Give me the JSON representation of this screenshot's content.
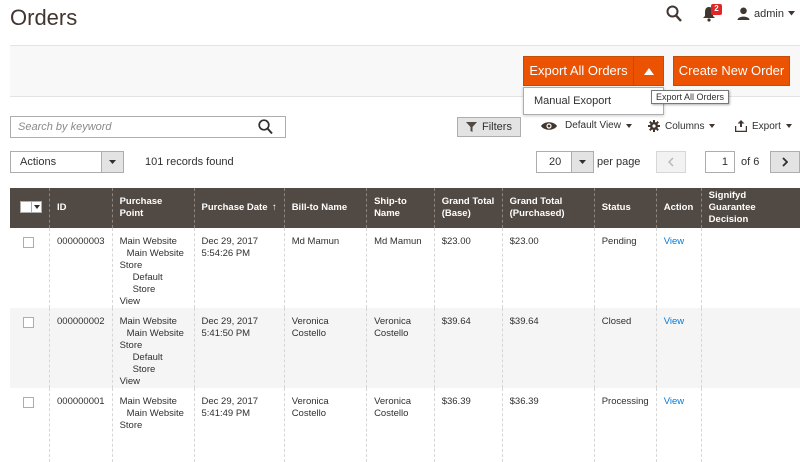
{
  "page": {
    "title": "Orders"
  },
  "topbar": {
    "notification_count": "2",
    "user": "admin"
  },
  "header_actions": {
    "export_all_label": "Export All Orders",
    "create_label": "Create New Order",
    "dropdown_item": "Manual Exoport",
    "tooltip": "Export All Orders"
  },
  "search": {
    "placeholder": "Search by keyword"
  },
  "toolbar": {
    "filters": "Filters",
    "default_view": "Default View",
    "columns": "Columns",
    "export": "Export"
  },
  "grid_controls": {
    "actions_label": "Actions",
    "records_found": "101 records found",
    "per_page_value": "20",
    "per_page_label": "per page",
    "current_page": "1",
    "total_pages": "of 6"
  },
  "table": {
    "columns": [
      "ID",
      "Purchase Point",
      "Purchase Date",
      "Bill-to Name",
      "Ship-to Name",
      "Grand Total (Base)",
      "Grand Total (Purchased)",
      "Status",
      "Action",
      "Signifyd Guarantee Decision"
    ],
    "rows": [
      {
        "id": "000000003",
        "pp1": "Main Website",
        "pp2": "Main Website",
        "pp3": "Store",
        "pp4": "Default Store",
        "pp5": "View",
        "date1": "Dec 29, 2017",
        "date2": "5:54:26 PM",
        "bill": "Md Mamun",
        "ship": "Md Mamun",
        "base": "$23.00",
        "purchased": "$23.00",
        "status": "Pending",
        "action": "View"
      },
      {
        "id": "000000002",
        "pp1": "Main Website",
        "pp2": "Main Website",
        "pp3": "Store",
        "pp4": "Default Store",
        "pp5": "View",
        "date1": "Dec 29, 2017",
        "date2": "5:41:50 PM",
        "bill": "Veronica Costello",
        "ship": "Veronica Costello",
        "base": "$39.64",
        "purchased": "$39.64",
        "status": "Closed",
        "action": "View"
      },
      {
        "id": "000000001",
        "pp1": "Main Website",
        "pp2": "Main Website",
        "pp3": "Store",
        "pp4": "",
        "pp5": "",
        "date1": "Dec 29, 2017",
        "date2": "5:41:49 PM",
        "bill": "Veronica Costello",
        "ship": "Veronica Costello",
        "base": "$36.39",
        "purchased": "$36.39",
        "status": "Processing",
        "action": "View"
      }
    ]
  },
  "colors": {
    "accent": "#eb5202",
    "header_bg": "#514943",
    "link": "#007bdb"
  }
}
